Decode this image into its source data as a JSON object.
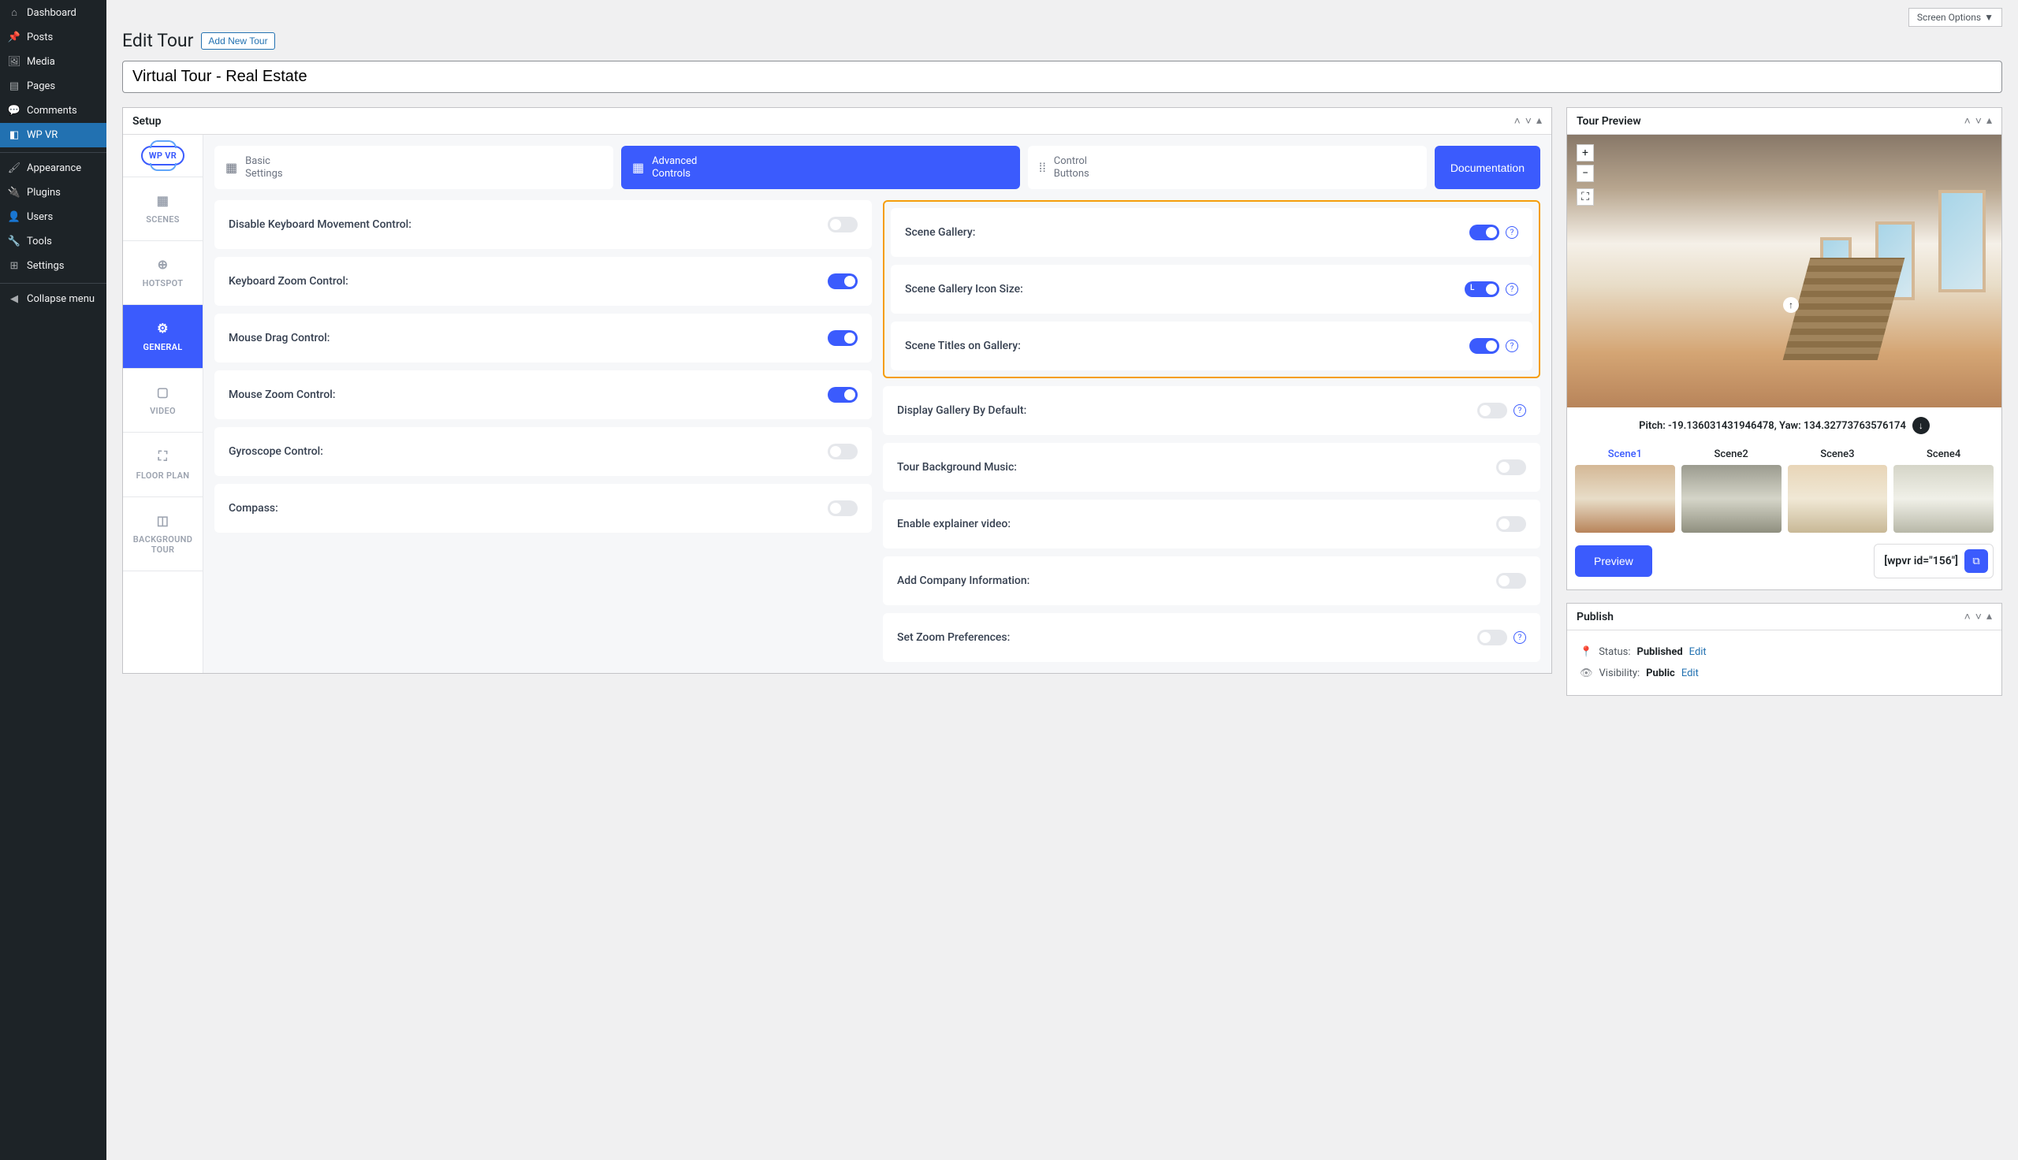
{
  "screen_options": "Screen Options",
  "page": {
    "title": "Edit Tour",
    "add_new": "Add New Tour"
  },
  "tour_title": "Virtual Tour - Real Estate",
  "sidebar": [
    {
      "icon": "⌂",
      "label": "Dashboard"
    },
    {
      "icon": "📌",
      "label": "Posts"
    },
    {
      "icon": "🖼",
      "label": "Media"
    },
    {
      "icon": "▤",
      "label": "Pages"
    },
    {
      "icon": "💬",
      "label": "Comments"
    },
    {
      "icon": "◧",
      "label": "WP VR",
      "active": true
    },
    {
      "icon": "🖌",
      "label": "Appearance",
      "sep": true
    },
    {
      "icon": "🔌",
      "label": "Plugins"
    },
    {
      "icon": "👤",
      "label": "Users"
    },
    {
      "icon": "🔧",
      "label": "Tools"
    },
    {
      "icon": "⊞",
      "label": "Settings"
    },
    {
      "icon": "◀",
      "label": "Collapse menu",
      "sep": true
    }
  ],
  "setup": {
    "title": "Setup",
    "logo": "WP VR",
    "vtabs": [
      {
        "label": "SCENES",
        "icon": "▦"
      },
      {
        "label": "HOTSPOT",
        "icon": "⊕"
      },
      {
        "label": "GENERAL",
        "icon": "⚙",
        "active": true
      },
      {
        "label": "VIDEO",
        "icon": "▢"
      },
      {
        "label": "FLOOR PLAN",
        "icon": "⛶"
      },
      {
        "label": "BACKGROUND TOUR",
        "icon": "◫"
      }
    ],
    "htabs": [
      {
        "icon": "▦",
        "label1": "Basic",
        "label2": "Settings"
      },
      {
        "icon": "▦",
        "label1": "Advanced",
        "label2": "Controls",
        "active": true
      },
      {
        "icon": "⁞⁞",
        "label1": "Control",
        "label2": "Buttons"
      }
    ],
    "doc_btn": "Documentation",
    "left_col": [
      {
        "label": "Disable Keyboard Movement Control:",
        "on": false
      },
      {
        "label": "Keyboard Zoom Control:",
        "on": true
      },
      {
        "label": "Mouse Drag Control:",
        "on": true
      },
      {
        "label": "Mouse Zoom Control:",
        "on": true
      },
      {
        "label": "Gyroscope Control:",
        "on": false
      },
      {
        "label": "Compass:",
        "on": false
      }
    ],
    "highlight": [
      {
        "label": "Scene Gallery:",
        "on": true,
        "info": true
      },
      {
        "label": "Scene Gallery Icon Size:",
        "size": "L",
        "info": true
      },
      {
        "label": "Scene Titles on Gallery:",
        "on": true,
        "info": true
      }
    ],
    "right_col": [
      {
        "label": "Display Gallery By Default:",
        "on": false,
        "info": true
      },
      {
        "label": "Tour Background Music:",
        "on": false
      },
      {
        "label": "Enable explainer video:",
        "on": false
      },
      {
        "label": "Add Company Information:",
        "on": false
      },
      {
        "label": "Set Zoom Preferences:",
        "on": false,
        "info": true
      }
    ]
  },
  "preview": {
    "title": "Tour Preview",
    "coords": "Pitch: -19.136031431946478, Yaw: 134.32773763576174",
    "scenes": [
      "Scene1",
      "Scene2",
      "Scene3",
      "Scene4"
    ],
    "preview_btn": "Preview",
    "shortcode": "[wpvr id=\"156\"]"
  },
  "publish": {
    "title": "Publish",
    "status_label": "Status:",
    "status_value": "Published",
    "visibility_label": "Visibility:",
    "visibility_value": "Public",
    "edit": "Edit"
  }
}
